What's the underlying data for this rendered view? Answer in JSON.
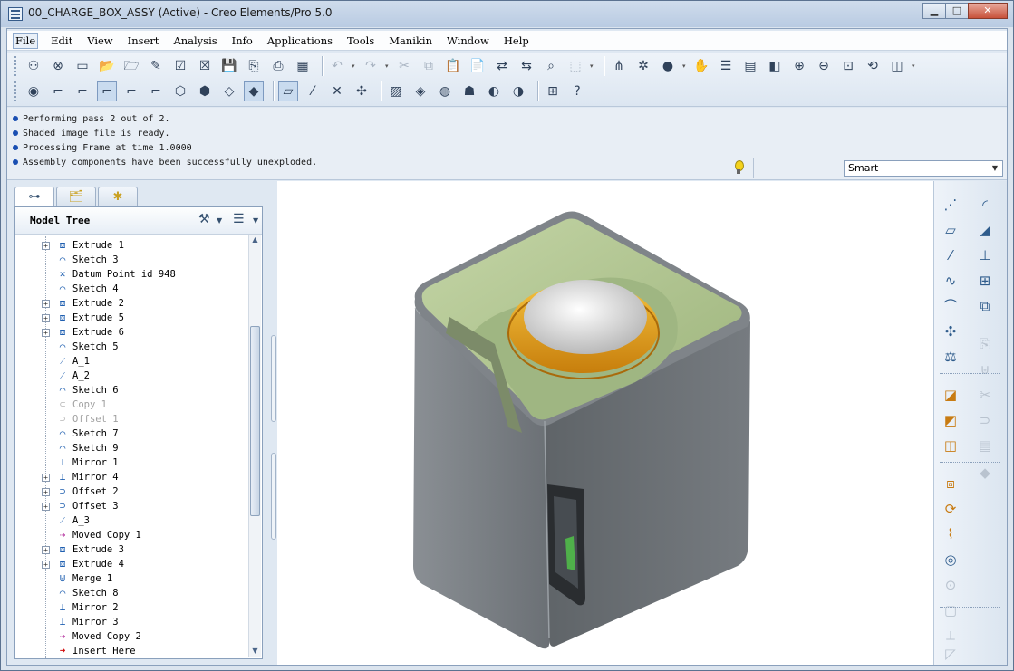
{
  "window": {
    "title": "00_CHARGE_BOX_ASSY (Active) - Creo Elements/Pro 5.0",
    "minimize": "▁",
    "maximize": "□",
    "close": "✕"
  },
  "menu": [
    "File",
    "Edit",
    "View",
    "Insert",
    "Analysis",
    "Info",
    "Applications",
    "Tools",
    "Manikin",
    "Window",
    "Help"
  ],
  "toolbar_row1_icons": [
    "new-session-icon",
    "erase-icon",
    "new-file-icon",
    "open-icon",
    "open-folder-icon",
    "edit-icon",
    "regenerate-icon",
    "close-window-icon",
    "save-icon",
    "save-copy-icon",
    "print-icon",
    "color-icon",
    "undo-icon",
    "redo-icon",
    "cut-icon",
    "copy-icon",
    "paste-icon",
    "paste-special-icon",
    "regenerate-manager-icon",
    "regen-icon",
    "find-icon",
    "select-box-icon",
    "datum-display-icon",
    "spin-center-icon",
    "shaded-sphere-icon",
    "pan-hand-icon",
    "layers-icon",
    "view-manager-icon",
    "view-icon",
    "zoom-in-icon",
    "zoom-out-icon",
    "refit-icon",
    "reorient-icon",
    "named-views-icon"
  ],
  "toolbar_row2_icons": [
    "model-player-icon",
    "sketch-view1-icon",
    "sketch-view2-icon",
    "sketch-view3-icon",
    "sketch-view4-icon",
    "sketch-view5-icon",
    "wireframe-icon",
    "hidden-line-icon",
    "no-hidden-icon",
    "shading-icon",
    "datum-planes-icon",
    "datum-axes-icon",
    "datum-points-icon",
    "coord-systems-icon",
    "annotations-icon",
    "appearance-icon",
    "render-icon",
    "photo-icon",
    "texture-icon",
    "scene-icon",
    "assembly-icon",
    "context-help-icon"
  ],
  "messages": [
    "Performing pass 2 out of 2.",
    "Shaded image file is ready.",
    "Processing Frame at time 1.0000",
    "Assembly components have been successfully unexploded."
  ],
  "filter": {
    "value": "Smart"
  },
  "model_tree": {
    "title": "Model Tree",
    "items": [
      {
        "label": "Extrude 1",
        "icon": "extrude-icon",
        "expand": true,
        "style": ""
      },
      {
        "label": "Sketch 3",
        "icon": "sketch-icon",
        "expand": false,
        "style": ""
      },
      {
        "label": "Datum Point id 948",
        "icon": "datum-point-icon",
        "expand": false,
        "style": ""
      },
      {
        "label": "Sketch 4",
        "icon": "sketch-icon",
        "expand": false,
        "style": ""
      },
      {
        "label": "Extrude 2",
        "icon": "extrude-icon",
        "expand": true,
        "style": ""
      },
      {
        "label": "Extrude 5",
        "icon": "extrude-icon",
        "expand": true,
        "style": ""
      },
      {
        "label": "Extrude 6",
        "icon": "extrude-icon",
        "expand": true,
        "style": ""
      },
      {
        "label": "Sketch 5",
        "icon": "sketch-icon",
        "expand": false,
        "style": ""
      },
      {
        "label": "A_1",
        "icon": "datum-axis-icon",
        "expand": false,
        "style": ""
      },
      {
        "label": "A_2",
        "icon": "datum-axis-icon",
        "expand": false,
        "style": ""
      },
      {
        "label": "Sketch 6",
        "icon": "sketch-icon",
        "expand": false,
        "style": ""
      },
      {
        "label": "Copy 1",
        "icon": "copy-feature-icon",
        "expand": false,
        "style": "dim"
      },
      {
        "label": "Offset 1",
        "icon": "offset-icon",
        "expand": false,
        "style": "dim"
      },
      {
        "label": "Sketch 7",
        "icon": "sketch-icon",
        "expand": false,
        "style": ""
      },
      {
        "label": "Sketch 9",
        "icon": "sketch-icon",
        "expand": false,
        "style": ""
      },
      {
        "label": "Mirror 1",
        "icon": "mirror-icon",
        "expand": false,
        "style": ""
      },
      {
        "label": "Mirror 4",
        "icon": "mirror-icon",
        "expand": true,
        "style": ""
      },
      {
        "label": "Offset 2",
        "icon": "offset-icon",
        "expand": true,
        "style": ""
      },
      {
        "label": "Offset 3",
        "icon": "offset-icon",
        "expand": true,
        "style": ""
      },
      {
        "label": "A_3",
        "icon": "datum-axis-icon",
        "expand": false,
        "style": ""
      },
      {
        "label": "Moved Copy 1",
        "icon": "moved-copy-icon",
        "expand": false,
        "style": "pink"
      },
      {
        "label": "Extrude 3",
        "icon": "extrude-icon",
        "expand": true,
        "style": ""
      },
      {
        "label": "Extrude 4",
        "icon": "extrude-icon",
        "expand": true,
        "style": ""
      },
      {
        "label": "Merge 1",
        "icon": "merge-icon",
        "expand": false,
        "style": ""
      },
      {
        "label": "Sketch 8",
        "icon": "sketch-icon",
        "expand": false,
        "style": ""
      },
      {
        "label": "Mirror 2",
        "icon": "mirror-icon",
        "expand": false,
        "style": ""
      },
      {
        "label": "Mirror 3",
        "icon": "mirror-icon",
        "expand": false,
        "style": ""
      },
      {
        "label": "Moved Copy 2",
        "icon": "moved-copy-icon",
        "expand": false,
        "style": "pink"
      },
      {
        "label": "Insert Here",
        "icon": "insert-here-icon",
        "expand": false,
        "style": "red"
      }
    ]
  },
  "right_toolbar_icons": [
    "datum-point-tool-icon",
    "datum-plane-tool-icon",
    "datum-axis-tool-icon",
    "curve-tool-icon",
    "sketch-tool-icon",
    "coord-sys-tool-icon",
    "analysis-tool-icon",
    "insert-annotation-icon",
    "note-icon",
    "symbol-icon",
    "extrude-tool-icon",
    "revolve-tool-icon",
    "sweep-tool-icon",
    "blend-tool-icon",
    "hole-tool-icon",
    "shell-tool-icon",
    "rib-tool-icon",
    "draft-tool-icon",
    "round-tool-icon",
    "chamfer-tool-icon",
    "mirror-tool-icon",
    "pattern-tool-icon",
    "copy-tool-icon",
    "paste-tool-icon",
    "merge-tool-icon",
    "trim-tool-icon",
    "offset-tool-icon",
    "thicken-tool-icon",
    "solidify-tool-icon"
  ],
  "colors": {
    "body_gray": "#6f7479",
    "lid_green": "#b0c48f",
    "ring_orange": "#e8a21f",
    "dome": "#e8e8e8"
  }
}
